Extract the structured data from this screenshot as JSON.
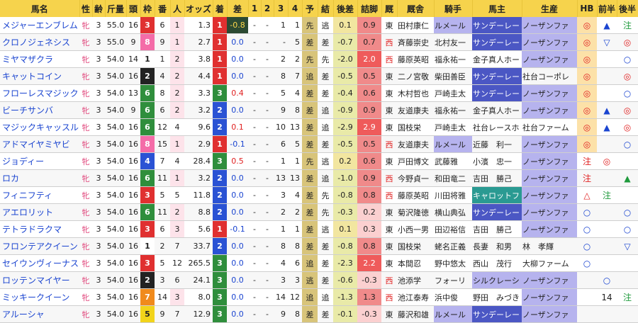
{
  "headers": [
    "馬名",
    "性",
    "齢",
    "斤量",
    "頭",
    "枠",
    "番",
    "人",
    "オッズ",
    "着",
    "差",
    "1",
    "2",
    "3",
    "4",
    "予",
    "結",
    "後差",
    "詰脚",
    "厩",
    "厩舎",
    "騎手",
    "馬主",
    "生産",
    "HB",
    "前半",
    "後半"
  ],
  "colors": {
    "header_bg": "#f6d34c",
    "waku": {
      "1": "#ffffff",
      "2": "#222222",
      "3": "#e03030",
      "4": "#2a52d4",
      "5": "#f2d41a",
      "6": "#2f8e3c",
      "7": "#f08a1c",
      "8": "#f46ca8"
    },
    "finish": {
      "1": "#e03030",
      "2": "#2a52d4",
      "3": "#2f8e3c"
    }
  },
  "rows": [
    {
      "name": "メジャーエンブレム",
      "sex": "牝",
      "age": "3",
      "weight": "55.0",
      "heads": "16",
      "waku": "3",
      "num": "6",
      "pop": "1",
      "odds": "1.3",
      "finish": "1",
      "diff": "-0.8",
      "c1": "-",
      "c2": "-",
      "c3": "1",
      "c4": "1",
      "pred": "先",
      "res": "逃",
      "after": "0.1",
      "close": "0.9",
      "stable": "東",
      "trainer": "田村康仁",
      "jockey": "ルメール",
      "owner": "サンデーレー",
      "farm": "ノーザンファ",
      "hb": "◎",
      "h1": "▲",
      "h2": "注"
    },
    {
      "name": "クロノジェネシス",
      "sex": "牝",
      "age": "3",
      "weight": "55.0",
      "heads": "9",
      "waku": "8",
      "num": "9",
      "pop": "1",
      "odds": "2.7",
      "finish": "1",
      "diff": "0.0",
      "c1": "-",
      "c2": "-",
      "c3": "-",
      "c4": "5",
      "pred": "差",
      "res": "差",
      "after": "-0.7",
      "close": "0.7",
      "stable": "西",
      "trainer": "斉藤崇史",
      "jockey": "北村友一",
      "owner": "サンデーレー",
      "farm": "ノーザンファ",
      "hb": "◎",
      "h1": "▽",
      "h2": "◎"
    },
    {
      "name": "ミヤマザクラ",
      "sex": "牝",
      "age": "3",
      "weight": "54.0",
      "heads": "14",
      "waku": "1",
      "num": "1",
      "pop": "2",
      "odds": "3.8",
      "finish": "1",
      "diff": "0.0",
      "c1": "-",
      "c2": "-",
      "c3": "2",
      "c4": "2",
      "pred": "先",
      "res": "先",
      "after": "-2.0",
      "close": "2.0",
      "stable": "西",
      "trainer": "藤原英昭",
      "jockey": "福永祐一",
      "owner": "金子真人ホー",
      "farm": "ノーザンファ",
      "hb": "◎",
      "h1": "",
      "h2": "○"
    },
    {
      "name": "キャットコイン",
      "sex": "牝",
      "age": "3",
      "weight": "54.0",
      "heads": "16",
      "waku": "2",
      "num": "4",
      "pop": "2",
      "odds": "4.4",
      "finish": "1",
      "diff": "0.0",
      "c1": "-",
      "c2": "-",
      "c3": "8",
      "c4": "7",
      "pred": "追",
      "res": "差",
      "after": "-0.5",
      "close": "0.5",
      "stable": "東",
      "trainer": "二ノ宮敬",
      "jockey": "柴田善臣",
      "owner": "サンデーレー",
      "farm": "社台コーポレ",
      "hb": "◎",
      "h1": "",
      "h2": "◎"
    },
    {
      "name": "フローレスマジック",
      "sex": "牝",
      "age": "3",
      "weight": "54.0",
      "heads": "13",
      "waku": "6",
      "num": "8",
      "pop": "2",
      "odds": "3.3",
      "finish": "3",
      "diff": "0.4",
      "c1": "-",
      "c2": "-",
      "c3": "5",
      "c4": "4",
      "pred": "差",
      "res": "差",
      "after": "-0.4",
      "close": "0.6",
      "stable": "東",
      "trainer": "木村哲也",
      "jockey": "戸崎圭太",
      "owner": "サンデーレー",
      "farm": "ノーザンファ",
      "hb": "◎",
      "h1": "",
      "h2": "○"
    },
    {
      "name": "ビーチサンバ",
      "sex": "牝",
      "age": "3",
      "weight": "54.0",
      "heads": "9",
      "waku": "6",
      "num": "6",
      "pop": "2",
      "odds": "3.2",
      "finish": "2",
      "diff": "0.0",
      "c1": "-",
      "c2": "-",
      "c3": "9",
      "c4": "8",
      "pred": "差",
      "res": "追",
      "after": "-0.9",
      "close": "0.9",
      "stable": "東",
      "trainer": "友道康夫",
      "jockey": "福永祐一",
      "owner": "金子真人ホー",
      "farm": "ノーザンファ",
      "hb": "◎",
      "h1": "▲",
      "h2": "◎"
    },
    {
      "name": "マジックキャッスル",
      "sex": "牝",
      "age": "3",
      "weight": "54.0",
      "heads": "16",
      "waku": "6",
      "num": "12",
      "pop": "4",
      "odds": "9.6",
      "finish": "2",
      "diff": "0.1",
      "c1": "-",
      "c2": "-",
      "c3": "10",
      "c4": "13",
      "pred": "差",
      "res": "追",
      "after": "-2.9",
      "close": "2.9",
      "stable": "東",
      "trainer": "国枝栄",
      "jockey": "戸崎圭太",
      "owner": "社台レースホ",
      "farm": "社台ファーム",
      "hb": "◎",
      "h1": "▲",
      "h2": "◎"
    },
    {
      "name": "アドマイヤミヤビ",
      "sex": "牝",
      "age": "3",
      "weight": "54.0",
      "heads": "16",
      "waku": "8",
      "num": "15",
      "pop": "1",
      "odds": "2.9",
      "finish": "1",
      "diff": "-0.1",
      "c1": "-",
      "c2": "-",
      "c3": "6",
      "c4": "5",
      "pred": "差",
      "res": "差",
      "after": "-0.5",
      "close": "0.5",
      "stable": "西",
      "trainer": "友道康夫",
      "jockey": "ルメール",
      "owner": "近藤　利一",
      "farm": "ノーザンファ",
      "hb": "◎",
      "h1": "",
      "h2": "○"
    },
    {
      "name": "ジョディー",
      "sex": "牝",
      "age": "3",
      "weight": "54.0",
      "heads": "16",
      "waku": "4",
      "num": "7",
      "pop": "4",
      "odds": "28.4",
      "finish": "3",
      "diff": "0.5",
      "c1": "-",
      "c2": "-",
      "c3": "1",
      "c4": "1",
      "pred": "先",
      "res": "逃",
      "after": "0.2",
      "close": "0.6",
      "stable": "東",
      "trainer": "戸田博文",
      "jockey": "武藤雅",
      "owner": "小濱　忠一",
      "farm": "ノーザンファ",
      "hb": "注",
      "h1": "◎",
      "h2": ""
    },
    {
      "name": "ロカ",
      "sex": "牝",
      "age": "3",
      "weight": "54.0",
      "heads": "16",
      "waku": "6",
      "num": "11",
      "pop": "1",
      "odds": "3.2",
      "finish": "2",
      "diff": "0.0",
      "c1": "-",
      "c2": "-",
      "c3": "13",
      "c4": "13",
      "pred": "差",
      "res": "追",
      "after": "-1.0",
      "close": "0.9",
      "stable": "西",
      "trainer": "今野貞一",
      "jockey": "和田竜二",
      "owner": "吉田　勝己",
      "farm": "ノーザンファ",
      "hb": "注",
      "h1": "",
      "h2": "▲"
    },
    {
      "name": "フィニフティ",
      "sex": "牝",
      "age": "3",
      "weight": "54.0",
      "heads": "16",
      "waku": "3",
      "num": "5",
      "pop": "5",
      "odds": "11.8",
      "finish": "2",
      "diff": "0.0",
      "c1": "-",
      "c2": "-",
      "c3": "3",
      "c4": "4",
      "pred": "差",
      "res": "先",
      "after": "-0.8",
      "close": "0.8",
      "stable": "西",
      "trainer": "藤原英昭",
      "jockey": "川田将雅",
      "owner": "キャロットフ",
      "farm": "ノーザンファ",
      "hb": "△",
      "h1": "注",
      "h2": ""
    },
    {
      "name": "アエロリット",
      "sex": "牝",
      "age": "3",
      "weight": "54.0",
      "heads": "16",
      "waku": "6",
      "num": "11",
      "pop": "2",
      "odds": "8.8",
      "finish": "2",
      "diff": "0.0",
      "c1": "-",
      "c2": "-",
      "c3": "2",
      "c4": "2",
      "pred": "差",
      "res": "先",
      "after": "-0.3",
      "close": "0.2",
      "stable": "東",
      "trainer": "菊沢隆徳",
      "jockey": "横山典弘",
      "owner": "サンデーレー",
      "farm": "ノーザンファ",
      "hb": "○",
      "h1": "",
      "h2": "○"
    },
    {
      "name": "テトラドラクマ",
      "sex": "牝",
      "age": "3",
      "weight": "54.0",
      "heads": "16",
      "waku": "3",
      "num": "6",
      "pop": "3",
      "odds": "5.6",
      "finish": "1",
      "diff": "-0.1",
      "c1": "-",
      "c2": "-",
      "c3": "1",
      "c4": "1",
      "pred": "差",
      "res": "逃",
      "after": "0.1",
      "close": "0.3",
      "stable": "東",
      "trainer": "小西一男",
      "jockey": "田辺裕信",
      "owner": "吉田　勝己",
      "farm": "ノーザンファ",
      "hb": "○",
      "h1": "",
      "h2": "○"
    },
    {
      "name": "フロンテアクイーン",
      "sex": "牝",
      "age": "3",
      "weight": "54.0",
      "heads": "16",
      "waku": "1",
      "num": "2",
      "pop": "7",
      "odds": "33.7",
      "finish": "2",
      "diff": "0.0",
      "c1": "-",
      "c2": "-",
      "c3": "8",
      "c4": "8",
      "pred": "差",
      "res": "差",
      "after": "-0.8",
      "close": "0.8",
      "stable": "東",
      "trainer": "国枝栄",
      "jockey": "蛯名正義",
      "owner": "長妻　和男",
      "farm": "林　孝輝",
      "hb": "○",
      "h1": "",
      "h2": "▽"
    },
    {
      "name": "セイウンヴィーナス",
      "sex": "牝",
      "age": "3",
      "weight": "54.0",
      "heads": "16",
      "waku": "3",
      "num": "5",
      "pop": "12",
      "odds": "265.5",
      "finish": "3",
      "diff": "0.0",
      "c1": "-",
      "c2": "-",
      "c3": "4",
      "c4": "6",
      "pred": "追",
      "res": "差",
      "after": "-2.3",
      "close": "2.2",
      "stable": "東",
      "trainer": "本間忍",
      "jockey": "野中悠太",
      "owner": "西山　茂行",
      "farm": "大柳ファーム",
      "hb": "○",
      "h1": "",
      "h2": ""
    },
    {
      "name": "ロッテンマイヤー",
      "sex": "牝",
      "age": "3",
      "weight": "54.0",
      "heads": "16",
      "waku": "2",
      "num": "3",
      "pop": "6",
      "odds": "24.1",
      "finish": "3",
      "diff": "0.0",
      "c1": "-",
      "c2": "-",
      "c3": "3",
      "c4": "3",
      "pred": "逃",
      "res": "差",
      "after": "-0.6",
      "close": "-0.3",
      "stable": "西",
      "trainer": "池添学",
      "jockey": "フォーリ",
      "owner": "シルクレーシ",
      "farm": "ノーザンファ",
      "hb": "",
      "h1": "○",
      "h2": ""
    },
    {
      "name": "ミッキークイーン",
      "sex": "牝",
      "age": "3",
      "weight": "54.0",
      "heads": "16",
      "waku": "7",
      "num": "14",
      "pop": "3",
      "odds": "8.0",
      "finish": "3",
      "diff": "0.0",
      "c1": "-",
      "c2": "-",
      "c3": "14",
      "c4": "12",
      "pred": "追",
      "res": "追",
      "after": "-1.3",
      "close": "1.3",
      "stable": "西",
      "trainer": "池江泰寿",
      "jockey": "浜中俊",
      "owner": "野田　みづき",
      "farm": "ノーザンファ",
      "hb": "",
      "h1": "14",
      "h2": "注"
    },
    {
      "name": "アルーシャ",
      "sex": "牝",
      "age": "3",
      "weight": "54.0",
      "heads": "16",
      "waku": "5",
      "num": "9",
      "pop": "7",
      "odds": "12.9",
      "finish": "3",
      "diff": "0.0",
      "c1": "-",
      "c2": "-",
      "c3": "9",
      "c4": "8",
      "pred": "差",
      "res": "差",
      "after": "-0.1",
      "close": "-0.3",
      "stable": "東",
      "trainer": "藤沢和雄",
      "jockey": "ルメール",
      "owner": "サンデーレー",
      "farm": "ノーザンファ",
      "hb": "",
      "h1": "",
      "h2": ""
    }
  ]
}
